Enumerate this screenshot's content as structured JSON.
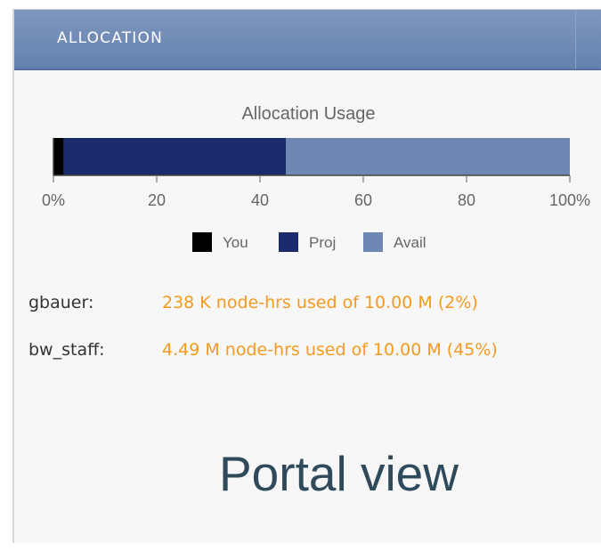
{
  "panel": {
    "title": "ALLOCATION"
  },
  "chart_data": {
    "type": "bar",
    "orientation": "horizontal",
    "stacked": true,
    "title": "Allocation Usage",
    "xlim": [
      0,
      100
    ],
    "tick_labels": [
      "0%",
      "20",
      "40",
      "60",
      "80",
      "100%"
    ],
    "tick_values": [
      0,
      20,
      40,
      60,
      80,
      100
    ],
    "series": [
      {
        "name": "You",
        "value": 2,
        "color": "#000000"
      },
      {
        "name": "Proj",
        "value": 43,
        "color": "#1a2b6b"
      },
      {
        "name": "Avail",
        "value": 55,
        "color": "#6f87b3"
      }
    ],
    "legend": "bottom-center"
  },
  "usage": [
    {
      "user": "gbauer:",
      "detail": "238 K node-hrs used of 10.00 M (2%)"
    },
    {
      "user": "bw_staff:",
      "detail": "4.49 M node-hrs used of 10.00 M (45%)"
    }
  ],
  "caption": "Portal view"
}
